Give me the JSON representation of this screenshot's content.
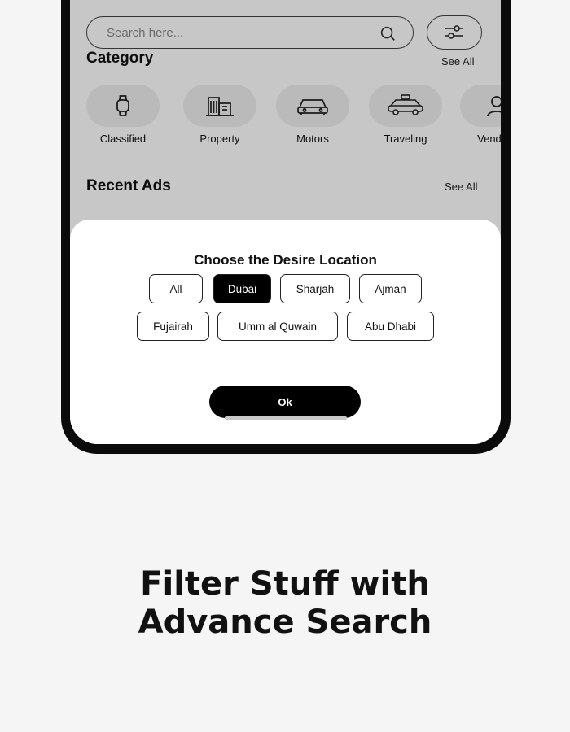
{
  "search": {
    "placeholder": "Search here...",
    "search_icon": "search-icon",
    "filter_icon": "sliders-icon"
  },
  "category": {
    "title": "Category",
    "see_all": "See All",
    "items": [
      {
        "label": "Classified",
        "icon": "watch-icon"
      },
      {
        "label": "Property",
        "icon": "building-icon"
      },
      {
        "label": "Motors",
        "icon": "car-icon"
      },
      {
        "label": "Traveling",
        "icon": "taxi-icon"
      },
      {
        "label": "Vendors",
        "icon": "person-icon"
      }
    ]
  },
  "recent_ads": {
    "title": "Recent Ads",
    "see_all": "See All"
  },
  "location_dialog": {
    "title": "Choose the Desire Location",
    "options": [
      "All",
      "Dubai",
      "Sharjah",
      "Ajman",
      "Fujairah",
      "Umm al Quwain",
      "Abu Dhabi"
    ],
    "selected": "Dubai",
    "ok_label": "Ok"
  },
  "caption": {
    "line1": "Filter Stuff with",
    "line2": "Advance Search"
  },
  "colors": {
    "background": "#f5f5f5",
    "phone_frame": "#0b0b0b",
    "accent": "#000000",
    "chip_bg": "#efefef"
  }
}
